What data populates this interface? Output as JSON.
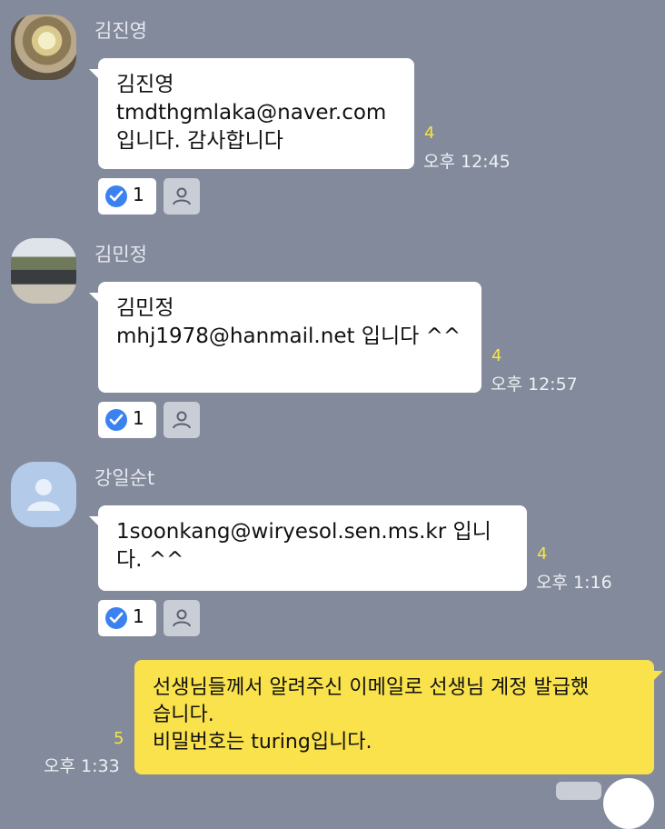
{
  "messages": [
    {
      "sender": "김진영",
      "lines": [
        "김진영",
        "tmdthgmlaka@naver.com",
        "입니다. 감사합니다"
      ],
      "unread": "4",
      "time": "오후 12:45",
      "reaction_count": "1"
    },
    {
      "sender": "김민정",
      "lines": [
        "김민정",
        "mhj1978@hanmail.net 입니다 ^^"
      ],
      "unread": "4",
      "time": "오후 12:57",
      "reaction_count": "1"
    },
    {
      "sender": "강일순t",
      "lines": [
        "1soonkang@wiryesol.sen.ms.kr 입니",
        "다. ^^"
      ],
      "unread": "4",
      "time": "오후 1:16",
      "reaction_count": "1"
    }
  ],
  "my_message": {
    "lines": [
      "선생님들께서 알려주신 이메일로 선생님 계정 발급했",
      "습니다.",
      "비밀번호는 turing입니다."
    ],
    "unread": "5",
    "time": "오후 1:33"
  },
  "colors": {
    "background": "#838a9c",
    "incoming_bubble": "#ffffff",
    "outgoing_bubble": "#f9e24c",
    "unread_count": "#f5e642",
    "reaction_check": "#3b82f0"
  },
  "icons": {
    "reaction": "check-circle-icon",
    "member": "person-icon",
    "default_avatar": "default-avatar-icon"
  }
}
